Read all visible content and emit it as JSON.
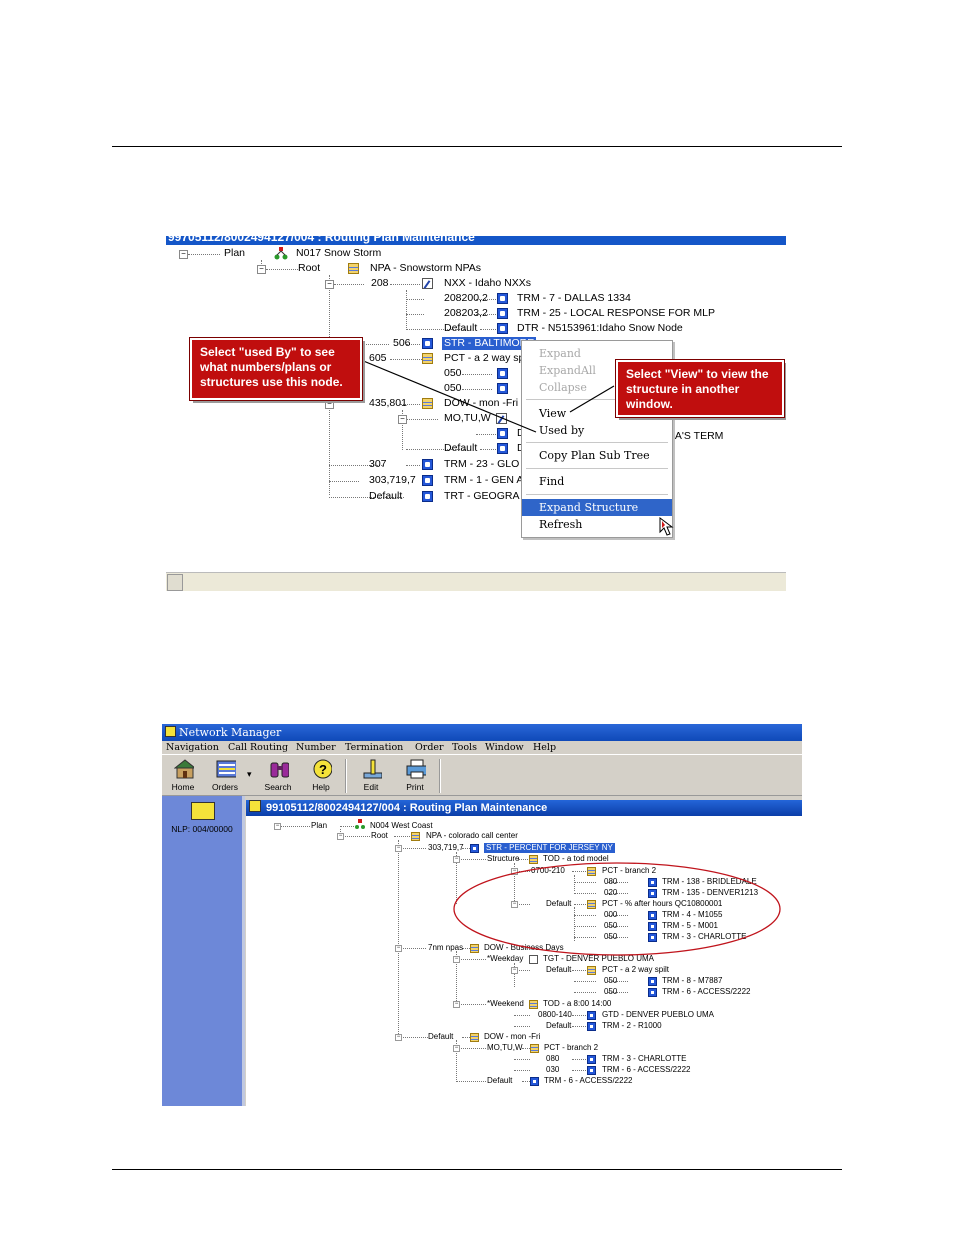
{
  "shot1": {
    "title_partial": "99705112/8002494127/004 : Routing Plan Maintenance",
    "tree": {
      "plan_label": "Plan",
      "plan_value": "N017  Snow Storm",
      "root_label": "Root",
      "root_value": "NPA - Snowstorm NPAs",
      "npa_208": "208",
      "nxx_208": "NXX - Idaho NXXs",
      "n208200": "208200,2",
      "trm7": "TRM - 7 - DALLAS 1334",
      "n208203": "208203,2",
      "trm25": "TRM - 25 - LOCAL RESPONSE FOR MLP",
      "default1": "Default",
      "dtr": "DTR - N5153961:Idaho Snow Node",
      "n506": "506",
      "str_balt": "STR - BALTIMORE",
      "n605": "605",
      "pct_605": "PCT - a 2 way sp",
      "n050a": "050",
      "n050b": "050",
      "n435": "435,801",
      "dow": "DOW - mon -Fri",
      "motuw": "MO,TU,W",
      "n_d1": "D",
      "as_term": "IA'S TERM",
      "default2": "Default",
      "n_d2": "D",
      "n307": "307",
      "trm23": "TRM - 23 - GLO",
      "n303": "303,719,7",
      "trm1": "TRM - 1 - GEN A",
      "default3": "Default",
      "trt": "TRT - GEOGRA"
    },
    "context_menu": {
      "expand": "Expand",
      "expand_all": "ExpandAll",
      "collapse": "Collapse",
      "view": "View",
      "used_by": "Used by",
      "copy_plan": "Copy Plan Sub Tree",
      "find": "Find",
      "expand_structure": "Expand Structure",
      "refresh": "Refresh"
    },
    "callout_left": "Select \"used By\" to see what numbers/plans or structures use this node.",
    "callout_right": "Select \"View\" to view the structure in another window."
  },
  "shot2": {
    "app_title": "Network Manager",
    "menu": [
      "Navigation",
      "Call Routing",
      "Number",
      "Termination",
      "Order",
      "Tools",
      "Window",
      "Help"
    ],
    "toolbar": {
      "home": "Home",
      "orders": "Orders",
      "search": "Search",
      "help": "Help",
      "edit": "Edit",
      "print": "Print"
    },
    "nav_label": "NLP: 004/00000",
    "window_title": "99105112/8002494127/004 : Routing Plan Maintenance",
    "tree": {
      "plan_label": "Plan",
      "plan_value": "N004  West Coast",
      "root_label": "Root",
      "root_value": "NPA - colorado call center",
      "n303": "303,719,7",
      "str": "STR - PERCENT FOR JERSEY NY",
      "structure": "Structure",
      "tod": "TOD - a tod model",
      "r0700": "0700-210",
      "pct_b2": "PCT - branch 2",
      "n080a": "080",
      "trm138": "TRM - 138 - BRIDLEDALE",
      "n020": "020",
      "trm135": "TRM - 135 - DENVER1213",
      "default_a": "Default",
      "pct_after": "PCT - % after hours QC10800001",
      "n000": "000",
      "trm4": "TRM - 4 - M1055",
      "n050a": "050",
      "trm5": "TRM - 5 - M001",
      "n050b": "050",
      "trm3a": "TRM - 3 - CHARLOTTE",
      "nm_npas": "7nm npas",
      "dow_bd": "DOW - Business Days",
      "weekday": "*Weekday",
      "tgt": "TGT - DENVER PUEBLO UMA",
      "default_b": "Default",
      "pct_2way": "PCT - a 2 way spilt",
      "n050c": "050",
      "trm8": "TRM - 8 - M7887",
      "n050d": "050",
      "trm6a": "TRM - 6 - ACCESS/2222",
      "weekend": "*Weekend",
      "tod_800": "TOD - a 8:00 14:00",
      "r0800": "0800-140",
      "gtd": "GTD - DENVER PUEBLO UMA",
      "default_c": "Default",
      "trm2": "TRM - 2 - R1000",
      "default_d": "Default",
      "dow_mf": "DOW - mon -Fri",
      "motuw": "MO,TU,W",
      "pct_b2b": "PCT - branch 2",
      "n080b": "080",
      "trm3b": "TRM - 3 - CHARLOTTE",
      "n030": "030",
      "trm6b": "TRM - 6 - ACCESS/2222",
      "default_e": "Default",
      "trm6c": "TRM - 6 - ACCESS/2222"
    }
  },
  "colors": {
    "callout": "#c00e0e",
    "selection": "#2a5fcf",
    "titlebar": "#1456c8",
    "ellipse": "#c0141c"
  }
}
